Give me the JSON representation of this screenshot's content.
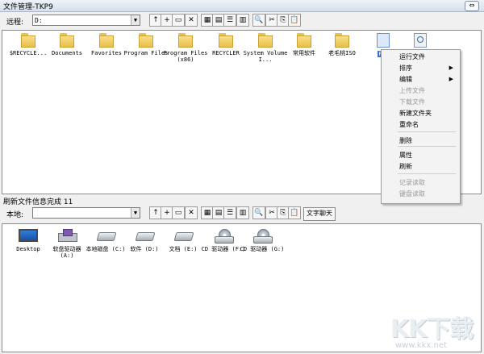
{
  "window": {
    "title": "文件管理-TKP9",
    "restore_glyph": "⇔"
  },
  "remote": {
    "label": "远程:",
    "path": "D:",
    "toolbar_icons": [
      "up-folder-icon",
      "new-folder-icon",
      "open-folder-icon",
      "delete-icon",
      "large-icons-view-icon",
      "small-icons-view-icon",
      "list-view-icon",
      "details-view-icon",
      "search-icon",
      "cut-icon",
      "copy-icon",
      "paste-icon"
    ],
    "toolbar_glyphs": [
      "↑",
      "+",
      "▭",
      "✕",
      "▦",
      "▤",
      "☰",
      "▥",
      "🔍",
      "✂",
      "⎘",
      "📋"
    ],
    "items": [
      {
        "name": "$RECYCLE...",
        "kind": "folder"
      },
      {
        "name": "Documents",
        "kind": "folder"
      },
      {
        "name": "Favorites",
        "kind": "folder"
      },
      {
        "name": "Program Files",
        "kind": "folder"
      },
      {
        "name": "Program Files (x86)",
        "kind": "folder"
      },
      {
        "name": "RECYCLER",
        "kind": "folder"
      },
      {
        "name": "System Volume I...",
        "kind": "folder"
      },
      {
        "name": "常用软件",
        "kind": "folder"
      },
      {
        "name": "老毛桃ISO",
        "kind": "folder"
      },
      {
        "name": "F盘",
        "kind": "file",
        "selected": true
      },
      {
        "name": "",
        "kind": "viewer"
      }
    ]
  },
  "context_menu": [
    {
      "label": "运行文件",
      "disabled": false,
      "submenu": false
    },
    {
      "label": "排序",
      "disabled": false,
      "submenu": true
    },
    {
      "label": "编辑",
      "disabled": false,
      "submenu": true
    },
    {
      "label": "上传文件",
      "disabled": true,
      "submenu": false
    },
    {
      "label": "下载文件",
      "disabled": true,
      "submenu": false
    },
    {
      "label": "新建文件夹",
      "disabled": false,
      "submenu": false
    },
    {
      "label": "重命名",
      "disabled": false,
      "submenu": false
    },
    {
      "label": "删除",
      "disabled": false,
      "submenu": false
    },
    {
      "label": "属性",
      "disabled": false,
      "submenu": false
    },
    {
      "label": "刷新",
      "disabled": false,
      "submenu": false
    },
    {
      "label": "记录读取",
      "disabled": true,
      "submenu": false
    },
    {
      "label": "键盘读取",
      "disabled": true,
      "submenu": false
    }
  ],
  "submenu_arrow": "▶",
  "status": "刷新文件信息完成 11",
  "local": {
    "label": "本地:",
    "path": "",
    "chat_button": "文字聊天",
    "items": [
      {
        "name": "Desktop",
        "kind": "desktop"
      },
      {
        "name": "软盘驱动器 (A:)",
        "kind": "floppy"
      },
      {
        "name": "本地磁盘 (C:)",
        "kind": "hdd"
      },
      {
        "name": "软件 (D:)",
        "kind": "hdd"
      },
      {
        "name": "文档 (E:)",
        "kind": "hdd"
      },
      {
        "name": "CD 驱动器 (F:)",
        "kind": "cd"
      },
      {
        "name": "CD 驱动器 (G:)",
        "kind": "cd"
      }
    ]
  },
  "watermark": {
    "logo": "KK下载",
    "url": "www.kkx.net"
  }
}
